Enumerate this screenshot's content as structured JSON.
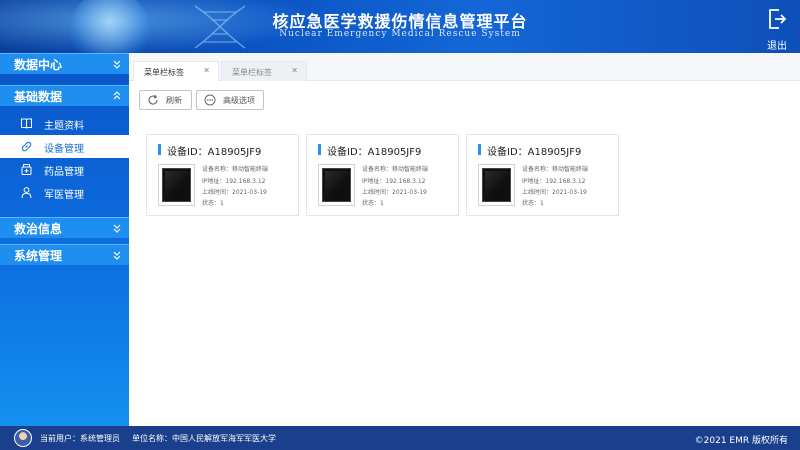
{
  "header": {
    "title": "核应急医学救援伤情信息管理平台",
    "subtitle": "Nuclear Emergency Medical Rescue System",
    "logout_label": "退出"
  },
  "sidebar": {
    "groups": [
      {
        "label": "数据中心",
        "state": "collapsed"
      },
      {
        "label": "基础数据",
        "state": "expanded",
        "items": [
          {
            "label": "主题资料",
            "icon": "book-icon"
          },
          {
            "label": "设备管理",
            "icon": "link-icon",
            "active": true
          },
          {
            "label": "药品管理",
            "icon": "medicine-icon"
          },
          {
            "label": "军医管理",
            "icon": "person-icon"
          }
        ]
      },
      {
        "label": "救治信息",
        "state": "collapsed"
      },
      {
        "label": "系统管理",
        "state": "collapsed"
      }
    ]
  },
  "tabs": [
    {
      "label": "菜单栏标签",
      "active": true
    },
    {
      "label": "菜单栏标签",
      "active": false
    }
  ],
  "toolbar": {
    "refresh_label": "刷新",
    "advanced_label": "高级选项"
  },
  "devices": [
    {
      "header": "设备ID：A18905JF9",
      "name": "设备名称：移动智能终端",
      "ip": "IP地址：192.168.3.12",
      "online": "上线时间：2021-03-19",
      "status": "状态：1"
    },
    {
      "header": "设备ID：A18905JF9",
      "name": "设备名称：移动智能终端",
      "ip": "IP地址：192.168.3.12",
      "online": "上线时间：2021-03-19",
      "status": "状态：1"
    },
    {
      "header": "设备ID：A18905JF9",
      "name": "设备名称：移动智能终端",
      "ip": "IP地址：192.168.3.12",
      "online": "上线时间：2021-03-19",
      "status": "状态：1"
    }
  ],
  "footer": {
    "current_user": "当前用户：系统管理员",
    "unit": "单位名称：中国人民解放军海军军医大学",
    "copyright": "©2021 EMR 版权所有"
  },
  "colors": {
    "header_blue": "#0c56c6",
    "sidebar_blue": "#0d6ee0",
    "accent": "#2f8ff0",
    "footer_blue": "#1a3f8c"
  }
}
